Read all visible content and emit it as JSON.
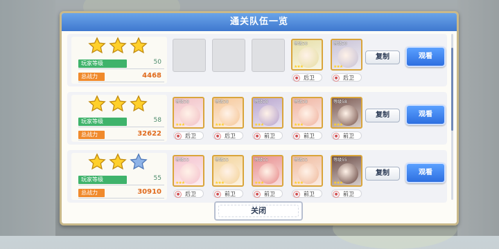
{
  "dialog": {
    "title": "通关队伍一览",
    "close_label": "关闭"
  },
  "labels": {
    "player_level": "玩家等级",
    "combat_power": "总战力",
    "copy": "复制",
    "view": "观看"
  },
  "teams": [
    {
      "stars_filled": 3,
      "player_level": "50",
      "combat_power": "4468",
      "members": [
        {
          "empty": true
        },
        {
          "empty": true
        },
        {
          "empty": true
        },
        {
          "empty": false,
          "level": "等级50",
          "position": "后卫",
          "color": "#e7dfa8"
        },
        {
          "empty": false,
          "level": "等级50",
          "position": "后卫",
          "color": "#c9c3d7"
        }
      ]
    },
    {
      "stars_filled": 3,
      "player_level": "58",
      "combat_power": "32622",
      "members": [
        {
          "empty": false,
          "level": "等级58",
          "position": "后卫",
          "color": "#f2c2c7"
        },
        {
          "empty": false,
          "level": "等级58",
          "position": "后卫",
          "color": "#f6c89a"
        },
        {
          "empty": false,
          "level": "等级58",
          "position": "前卫",
          "color": "#b9a6cf"
        },
        {
          "empty": false,
          "level": "等级58",
          "position": "前卫",
          "color": "#f0b5a2"
        },
        {
          "empty": false,
          "level": "等级58",
          "position": "前卫",
          "color": "#7c5a52"
        }
      ]
    },
    {
      "stars_filled": 2,
      "player_level": "55",
      "combat_power": "30910",
      "members": [
        {
          "empty": false,
          "level": "等级55",
          "position": "后卫",
          "color": "#f5c4cf"
        },
        {
          "empty": false,
          "level": "等级55",
          "position": "前卫",
          "color": "#f4d49c"
        },
        {
          "empty": false,
          "level": "等级55",
          "position": "前卫",
          "color": "#e88f8f"
        },
        {
          "empty": false,
          "level": "等级55",
          "position": "前卫",
          "color": "#f0bca0"
        },
        {
          "empty": false,
          "level": "等级55",
          "position": "前卫",
          "color": "#6e4e48"
        }
      ]
    }
  ]
}
